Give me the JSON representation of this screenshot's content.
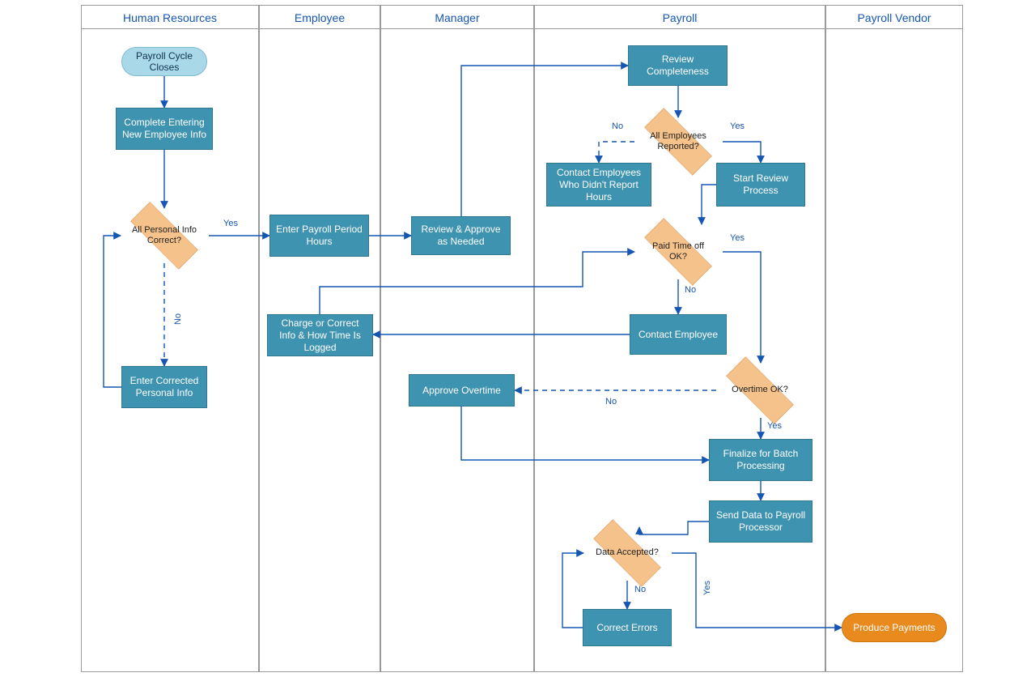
{
  "lanes": {
    "hr": "Human Resources",
    "employee": "Employee",
    "manager": "Manager",
    "payroll": "Payroll",
    "vendor": "Payroll Vendor"
  },
  "nodes": {
    "start": "Payroll Cycle Closes",
    "completeInfo": "Complete Entering New Employee Info",
    "allPersonal": "All Personal Info Correct?",
    "enterCorrected": "Enter Corrected Personal Info",
    "enterHours": "Enter Payroll Period Hours",
    "reviewApprove": "Review & Approve as Needed",
    "chargeCorrect": "Charge or Correct Info & How Time Is Logged",
    "approveOT": "Approve Overtime",
    "reviewComplete": "Review Completeness",
    "allReported": "All Employees Reported?",
    "contactNoReport": "Contact Employees Who Didn't Report Hours",
    "startReview": "Start Review Process",
    "ptoOK": "Paid Time off OK?",
    "contactEmp": "Contact Employee",
    "otOK": "Overtime OK?",
    "finalize": "Finalize for Batch Processing",
    "sendData": "Send Data to Payroll Processor",
    "dataAccepted": "Data Accepted?",
    "correctErrors": "Correct Errors",
    "produce": "Produce Payments"
  },
  "labels": {
    "yes": "Yes",
    "no": "No"
  }
}
